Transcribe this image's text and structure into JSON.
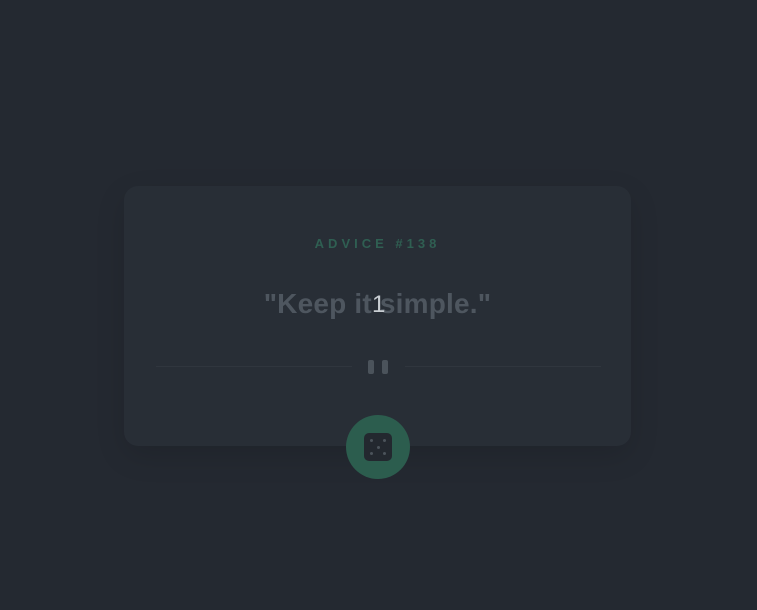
{
  "card": {
    "advice_label": "ADVICE #138",
    "quote": "\"Keep it simple.\"",
    "overlay_number": "1"
  },
  "icons": {
    "divider": "pause-icon",
    "button": "dice-icon"
  },
  "colors": {
    "background": "#242931",
    "card": "#282e36",
    "accent": "#2c5d4e",
    "label": "#2f5f52",
    "quote": "#4e565f"
  }
}
